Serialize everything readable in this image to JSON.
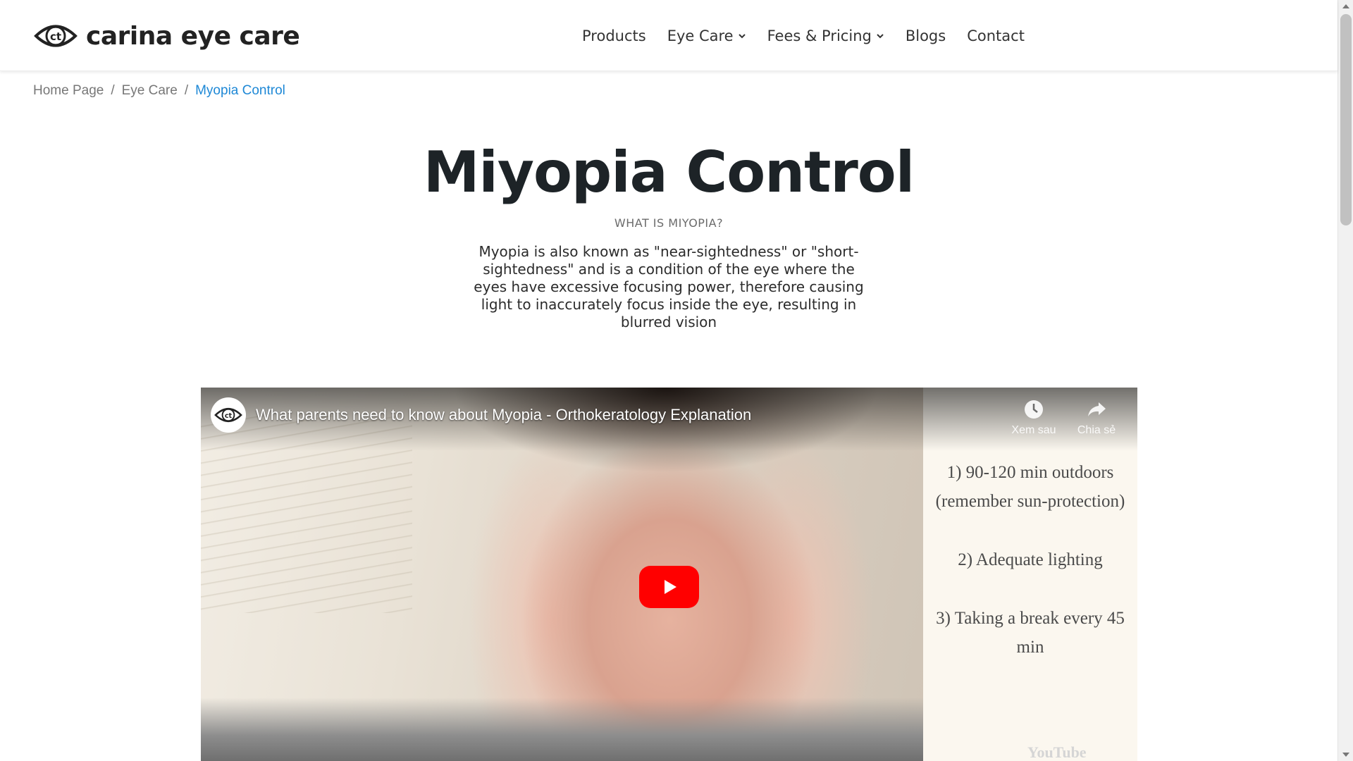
{
  "header": {
    "logo_text": "carina eye care",
    "nav": [
      {
        "label": "Products"
      },
      {
        "label": "Eye Care"
      },
      {
        "label": "Fees & Pricing"
      },
      {
        "label": "Blogs"
      },
      {
        "label": "Contact"
      }
    ]
  },
  "breadcrumb": {
    "items": [
      "Home Page",
      "Eye Care",
      "Myopia Control"
    ],
    "separator": "/"
  },
  "main": {
    "title": "Miyopia Control",
    "subtitle": "WHAT IS MIYOPIA?",
    "description": "Myopia is also known as \"near-sightedness\" or \"short-sightedness\" and is a condition of the eye where the eyes have excessive focusing power, therefore causing light to inaccurately focus inside the eye, resulting in blurred vision"
  },
  "video": {
    "title": "What parents need to know about Myopia - Orthokeratology Explanation",
    "watch_later_label": "Xem sau",
    "share_label": "Chia sẻ",
    "tips": [
      "1) 90-120 min outdoors (remember sun-protection)",
      "2) Adequate lighting",
      "3) Taking a break every 45 min"
    ],
    "brand": "YouTube"
  },
  "colors": {
    "accent": "#1e88d6",
    "play_button": "#ff0000",
    "title_text": "#1d2327"
  }
}
